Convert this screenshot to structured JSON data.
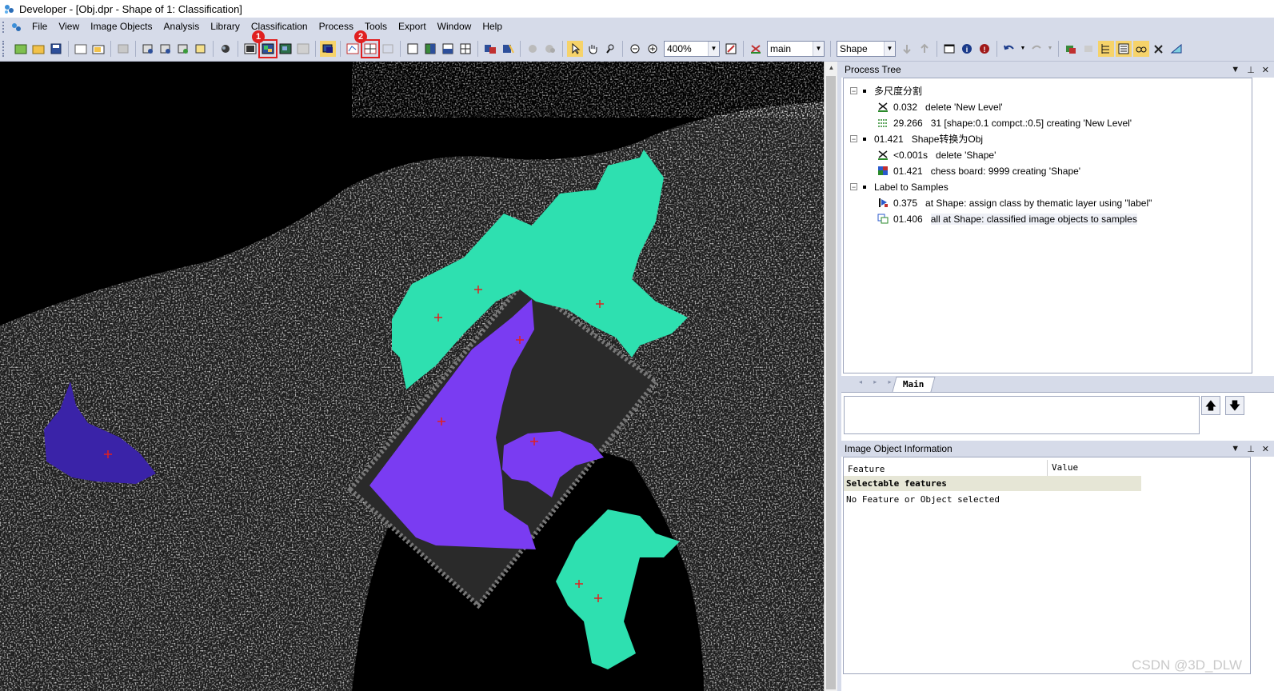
{
  "window": {
    "title": "Developer - [Obj.dpr - Shape of 1: Classification]"
  },
  "menu": [
    "File",
    "View",
    "Image Objects",
    "Analysis",
    "Library",
    "Classification",
    "Process",
    "Tools",
    "Export",
    "Window",
    "Help"
  ],
  "toolbar": {
    "zoom_value": "400%",
    "process_combo": "main",
    "level_combo": "Shape",
    "markers": [
      "1",
      "2"
    ]
  },
  "process_tree": {
    "title": "Process Tree",
    "rows": [
      {
        "label": "多尺度分割"
      },
      {
        "time": "0.032",
        "label": "delete 'New Level'"
      },
      {
        "time": "29.266",
        "label": "31 [shape:0.1 compct.:0.5] creating 'New Level'"
      },
      {
        "time": "01.421",
        "label": "Shape转换为Obj"
      },
      {
        "time": "<0.001s",
        "label": "delete 'Shape'"
      },
      {
        "time": "01.421",
        "label": "chess board: 9999 creating 'Shape'"
      },
      {
        "label": "Label to Samples"
      },
      {
        "time": "0.375",
        "label": "at  Shape: assign class by thematic layer using \"label\""
      },
      {
        "time": "01.406",
        "label": "all at  Shape: classified image objects to samples"
      }
    ],
    "tab": "Main"
  },
  "image_object_info": {
    "title": "Image Object Information",
    "col_feature": "Feature",
    "col_value": "Value",
    "group": "Selectable features",
    "message": "No Feature or Object selected"
  },
  "colors": {
    "teal": "#2ee0b0",
    "purple": "#7a3cf2",
    "dark_purple": "#3a23a8",
    "marker": "#e02020"
  },
  "watermark": "CSDN @3D_DLW"
}
